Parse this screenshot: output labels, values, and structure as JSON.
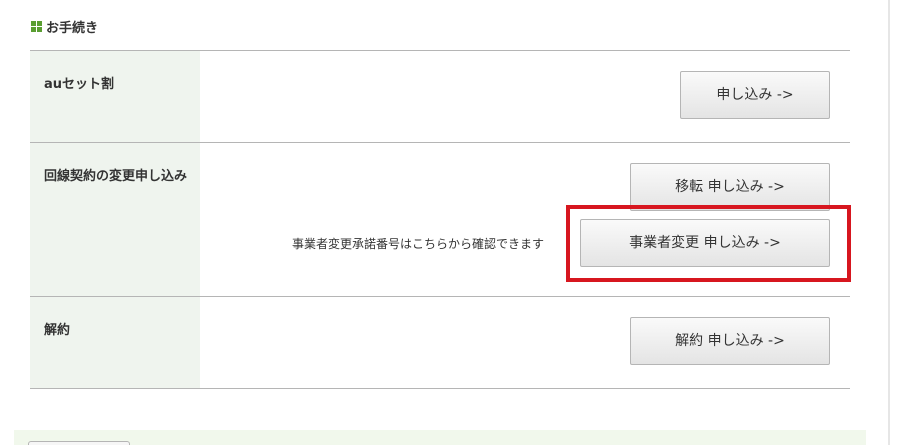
{
  "section": {
    "title": "お手続き"
  },
  "rows": [
    {
      "label": "auセット割",
      "button": "申し込み ->"
    },
    {
      "label": "回線契約の変更申し込み",
      "transfer_button": "移転 申し込み ->",
      "note": "事業者変更承諾番号はこちらから確認できます",
      "carrier_button": "事業者変更 申し込み ->"
    },
    {
      "label": "解約",
      "button": "解約 申し込み ->"
    }
  ],
  "colors": {
    "label_bg": "#eff4ee",
    "highlight": "#d7161f",
    "icon_green": "#5a9e32"
  }
}
